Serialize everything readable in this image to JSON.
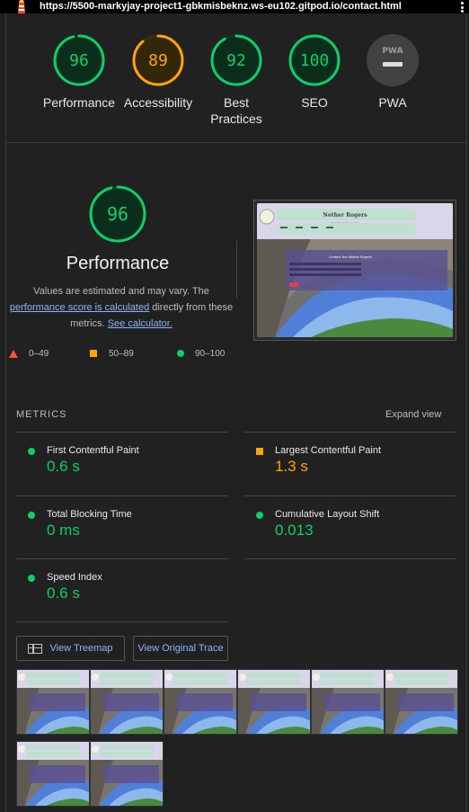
{
  "browser": {
    "url": "https://5500-markyjay-project1-gbkmisbeknz.ws-eu102.gitpod.io/contact.html",
    "logo_icon": "lighthouse-icon",
    "menu_icon": "kebab-menu-icon"
  },
  "summary_gauges": [
    {
      "label": "Performance",
      "score": "96",
      "value": 96,
      "color": "#0cce6b"
    },
    {
      "label": "Accessibility",
      "score": "89",
      "value": 89,
      "color": "#ffa400"
    },
    {
      "label": "Best Practices",
      "score": "92",
      "value": 92,
      "color": "#0cce6b"
    },
    {
      "label": "SEO",
      "score": "100",
      "value": 100,
      "color": "#0cce6b"
    },
    {
      "label": "PWA",
      "score": "PWA",
      "value": 0,
      "color": "#9e9e9e"
    }
  ],
  "performance": {
    "score": "96",
    "value": 96,
    "title": "Performance",
    "desc_1": "Values are estimated and may vary. The",
    "desc_link": "performance score is calculated",
    "desc_2": " directly from these metrics.",
    "calc_link": "See calculator."
  },
  "legend": {
    "fail": "0–49",
    "average": "50–89",
    "pass": "90–100"
  },
  "screenshot": {
    "site_title": "Nother Rogers",
    "site_tagline": "\"Your local co-guide\"",
    "form_heading": "Contact the Mother Rogers!"
  },
  "metrics": {
    "heading": "METRICS",
    "expand_label": "Expand view",
    "items": [
      {
        "name": "First Contentful Paint",
        "value": "0.6 s",
        "status": "pass"
      },
      {
        "name": "Largest Contentful Paint",
        "value": "1.3 s",
        "status": "average"
      },
      {
        "name": "Total Blocking Time",
        "value": "0 ms",
        "status": "pass"
      },
      {
        "name": "Cumulative Layout Shift",
        "value": "0.013",
        "status": "pass"
      },
      {
        "name": "Speed Index",
        "value": "0.6 s",
        "status": "pass"
      }
    ]
  },
  "buttons": {
    "treemap": "View Treemap",
    "trace": "View Original Trace"
  },
  "filmstrip": {
    "frame_count": 8
  },
  "colors": {
    "pass": "#0cce6b",
    "average": "#ffa400",
    "fail": "#ff4e42",
    "background": "#212121",
    "link": "#8ab4f8"
  }
}
